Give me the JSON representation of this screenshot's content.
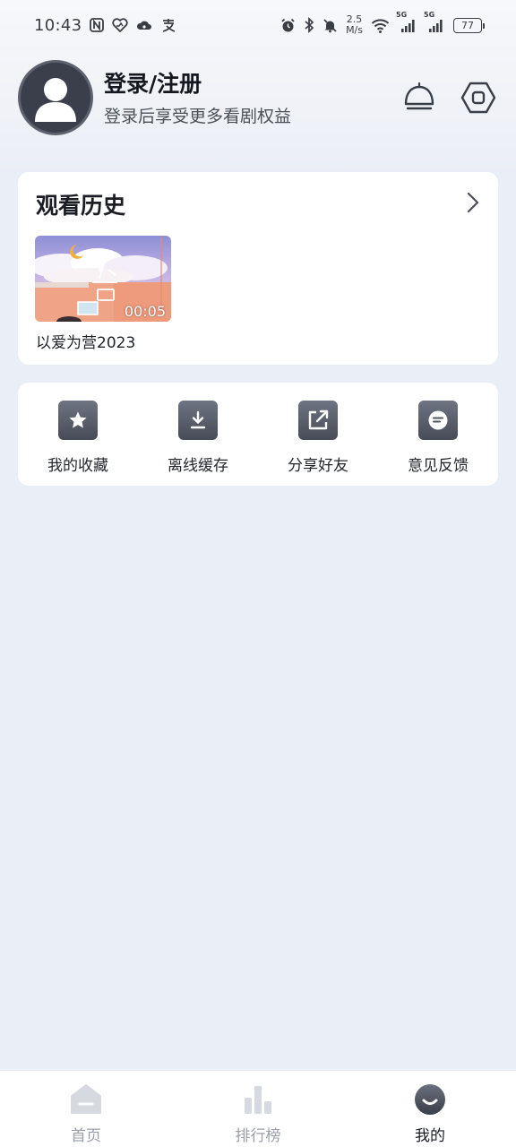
{
  "status_bar": {
    "time": "10:43",
    "network_speed_value": "2.5",
    "network_speed_unit": "M/s",
    "signal_1_label": "5G",
    "signal_2_label": "5G",
    "battery": "77",
    "left_icons": [
      "nfc-icon",
      "huawei-health-icon",
      "weather-icon",
      "alipay-icon"
    ],
    "right_icons": [
      "alarm-icon",
      "bluetooth-icon",
      "mute-icon",
      "wifi-icon",
      "signal-icon",
      "signal-icon"
    ]
  },
  "profile": {
    "title": "登录/注册",
    "subtitle": "登录后享受更多看剧权益",
    "icons": [
      "notification-bell-icon",
      "settings-hexagon-icon"
    ]
  },
  "history": {
    "title": "观看历史",
    "items": [
      {
        "title": "以爱为营2023",
        "duration": "00:05"
      }
    ]
  },
  "menu": {
    "items": [
      {
        "label": "我的收藏",
        "icon": "star-icon"
      },
      {
        "label": "离线缓存",
        "icon": "download-icon"
      },
      {
        "label": "分享好友",
        "icon": "share-icon"
      },
      {
        "label": "意见反馈",
        "icon": "feedback-icon"
      }
    ]
  },
  "bottom_nav": {
    "items": [
      {
        "label": "首页",
        "icon": "home-icon",
        "active": false
      },
      {
        "label": "排行榜",
        "icon": "ranking-icon",
        "active": false
      },
      {
        "label": "我的",
        "icon": "profile-icon",
        "active": true
      }
    ]
  },
  "colors": {
    "background": "#eaeef6",
    "card": "#ffffff",
    "icon_dark": "#474b57",
    "nav_inactive": "#9a9ea8",
    "nav_active": "#1b1e25"
  }
}
